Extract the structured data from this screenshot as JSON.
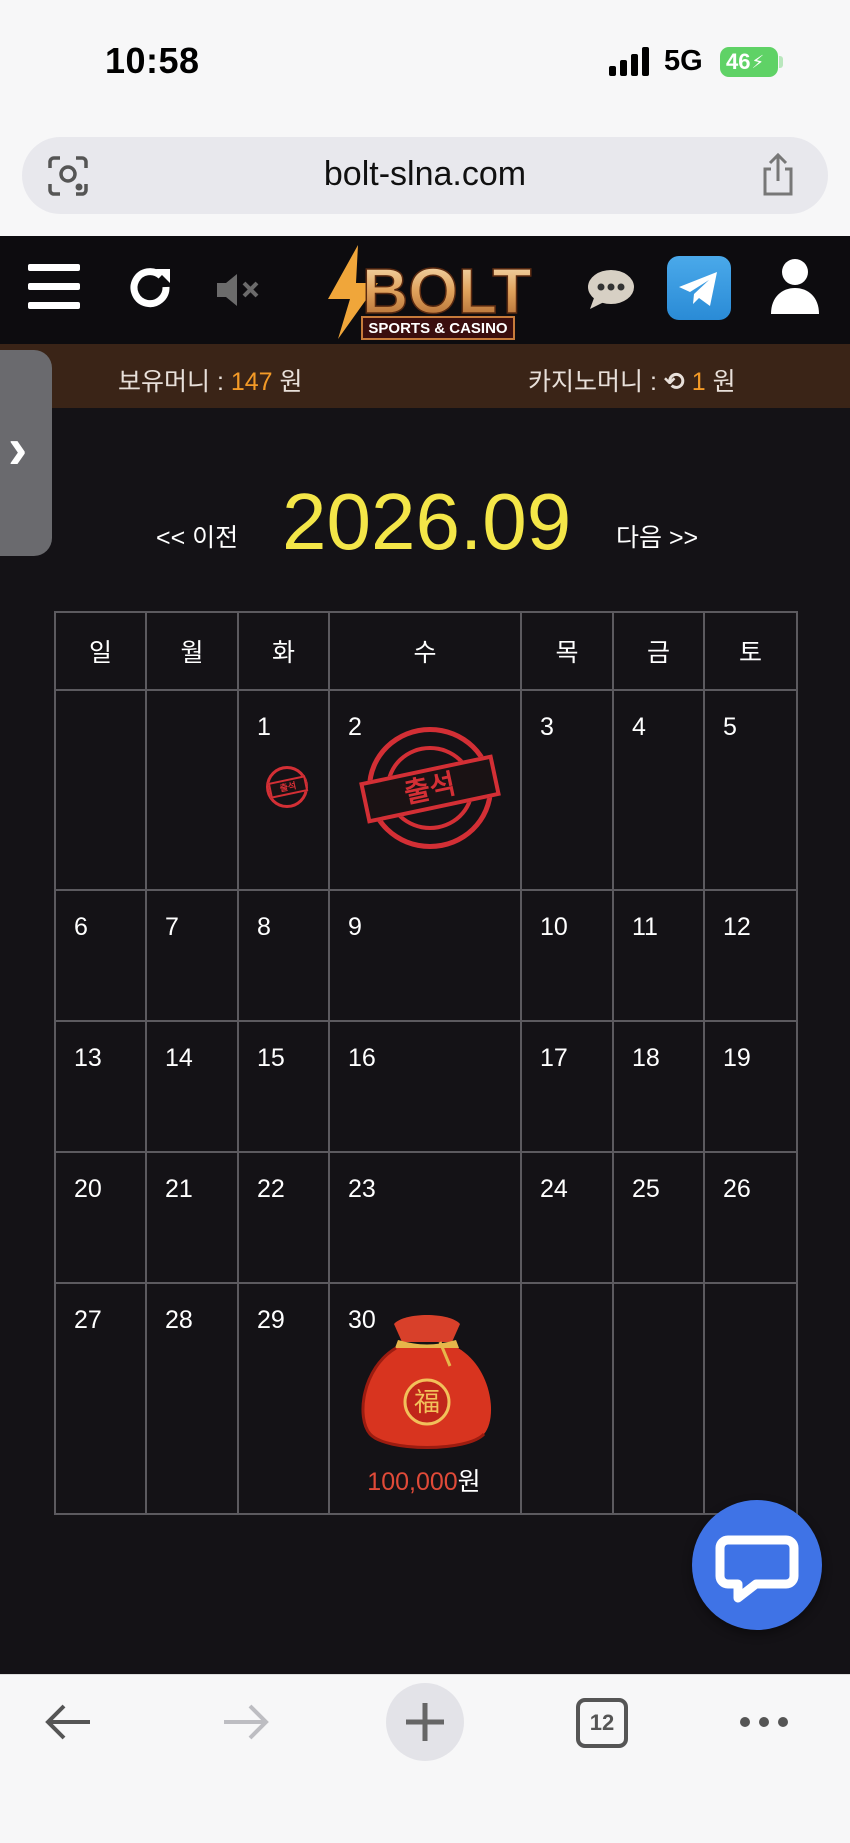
{
  "status": {
    "time": "10:58",
    "network": "5G",
    "battery": "46"
  },
  "browser": {
    "url": "bolt-slna.com",
    "tabs_count": "12"
  },
  "header": {
    "logo_text": "BOLT",
    "logo_sub": "SPORTS & CASINO"
  },
  "money": {
    "holding_label": "보유머니 :",
    "holding_value": "147",
    "casino_label": "카지노머니 :",
    "casino_value": "1",
    "unit": "원"
  },
  "calendar": {
    "prev_label": "<< 이전",
    "next_label": "다음 >>",
    "month": "2026.09",
    "weekdays": [
      "일",
      "월",
      "화",
      "수",
      "목",
      "금",
      "토"
    ],
    "weeks": [
      [
        "",
        "",
        "1",
        "2",
        "3",
        "4",
        "5"
      ],
      [
        "6",
        "7",
        "8",
        "9",
        "10",
        "11",
        "12"
      ],
      [
        "13",
        "14",
        "15",
        "16",
        "17",
        "18",
        "19"
      ],
      [
        "20",
        "21",
        "22",
        "23",
        "24",
        "25",
        "26"
      ],
      [
        "27",
        "28",
        "29",
        "30",
        "",
        "",
        ""
      ]
    ],
    "stamp_text": "출석",
    "reward_amount": "100,000",
    "reward_unit": "원",
    "bag_char": "福"
  },
  "colors": {
    "accent_yellow": "#f4e648",
    "money_orange": "#f39a27",
    "stamp_red": "#d32f35",
    "fab_blue": "#3f73e6"
  }
}
